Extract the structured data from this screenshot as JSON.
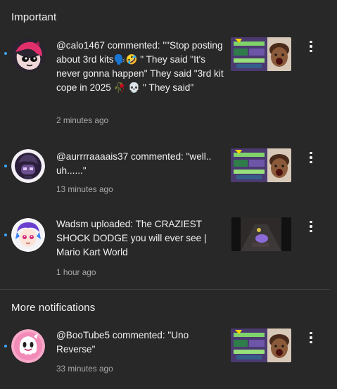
{
  "sections": {
    "important": {
      "heading": "Important"
    },
    "more": {
      "heading": "More notifications"
    }
  },
  "notifications": [
    {
      "text": "@calo1467 commented: \"\"Stop posting about 3rd kits🗣️🤣 \" They said \"It's never gonna happen\" They said \"3rd kit cope in 2025 🥀 💀 \" They said\"",
      "time": "2 minutes ago",
      "avatar_icon": "splatoon-character-avatar",
      "thumbnail": "mario-kart-reaction-thumbnail",
      "unread": true
    },
    {
      "text": "@aurrrraaaais37 commented: \"well.. uh......\"",
      "time": "13 minutes ago",
      "avatar_icon": "purple-character-avatar",
      "thumbnail": "mario-kart-reaction-thumbnail",
      "unread": true
    },
    {
      "text": "Wadsm uploaded: The CRAZIEST SHOCK DODGE you will ever see | Mario Kart World",
      "time": "1 hour ago",
      "avatar_icon": "channel-avatar-wadsm",
      "thumbnail": "mario-kart-gameplay-thumbnail",
      "unread": true
    },
    {
      "text": "@BooTube5 commented: \"Uno Reverse\"",
      "time": "33 minutes ago",
      "avatar_icon": "boo-ghost-avatar",
      "thumbnail": "mario-kart-reaction-thumbnail",
      "unread": true
    }
  ],
  "colors": {
    "background": "#282828",
    "text_primary": "#f1f1f1",
    "text_secondary": "#aaaaaa",
    "unread_dot": "#3ea6ff",
    "divider": "#3f3f3f"
  },
  "icons": {
    "menu": "more-vertical-icon"
  }
}
